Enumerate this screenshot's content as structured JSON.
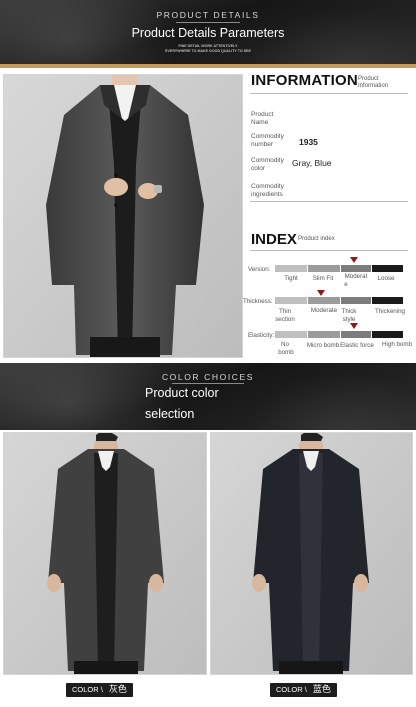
{
  "header": {
    "kicker": "PRODUCT DETAILS",
    "title": "Product Details Parameters",
    "sub_line1": "FINE DETAIL WORK ATTENTIVELY",
    "sub_line2": "EVERYWHERE TO MAKE GOOD QUALITY TO SEE"
  },
  "information": {
    "heading": "INFORMATION",
    "heading_sub_1": "Product",
    "heading_sub_2": "Information",
    "product_name_label_1": "Product",
    "product_name_label_2": "Name",
    "commodity_number_label_1": "Commodity",
    "commodity_number_label_2": "number",
    "commodity_number_value": "1935",
    "commodity_color_label_1": "Commodity",
    "commodity_color_label_2": "color",
    "commodity_color_value": "Gray, Blue",
    "ingredients_label_1": "Commodity",
    "ingredients_label_2": "ingredients"
  },
  "index": {
    "heading": "INDEX",
    "heading_sub": "Product index",
    "version": {
      "label": "Version:",
      "options": [
        "Tight",
        "Slim Fit",
        "Moderat",
        "e",
        "Loose"
      ],
      "selected": 3
    },
    "thickness": {
      "label": "Thickness:",
      "options": [
        "Thin",
        "section",
        "Moderate",
        "Thick",
        "style",
        "Thickening"
      ],
      "selected": 2
    },
    "elasticity": {
      "label": "Elasticity:",
      "options": [
        "No",
        "bomb",
        "Micro bomb",
        "Elastic force",
        "High bomb"
      ],
      "selected": 2
    }
  },
  "color_section": {
    "kicker": "COLOR CHOICES",
    "title_line1": "Product color",
    "title_line2": "selection"
  },
  "colors": [
    {
      "label": "COLOR \\",
      "name": "灰色",
      "swatch": "#3c3c3c"
    },
    {
      "label": "COLOR \\",
      "name": "蓝色",
      "swatch": "#1f2229"
    }
  ]
}
